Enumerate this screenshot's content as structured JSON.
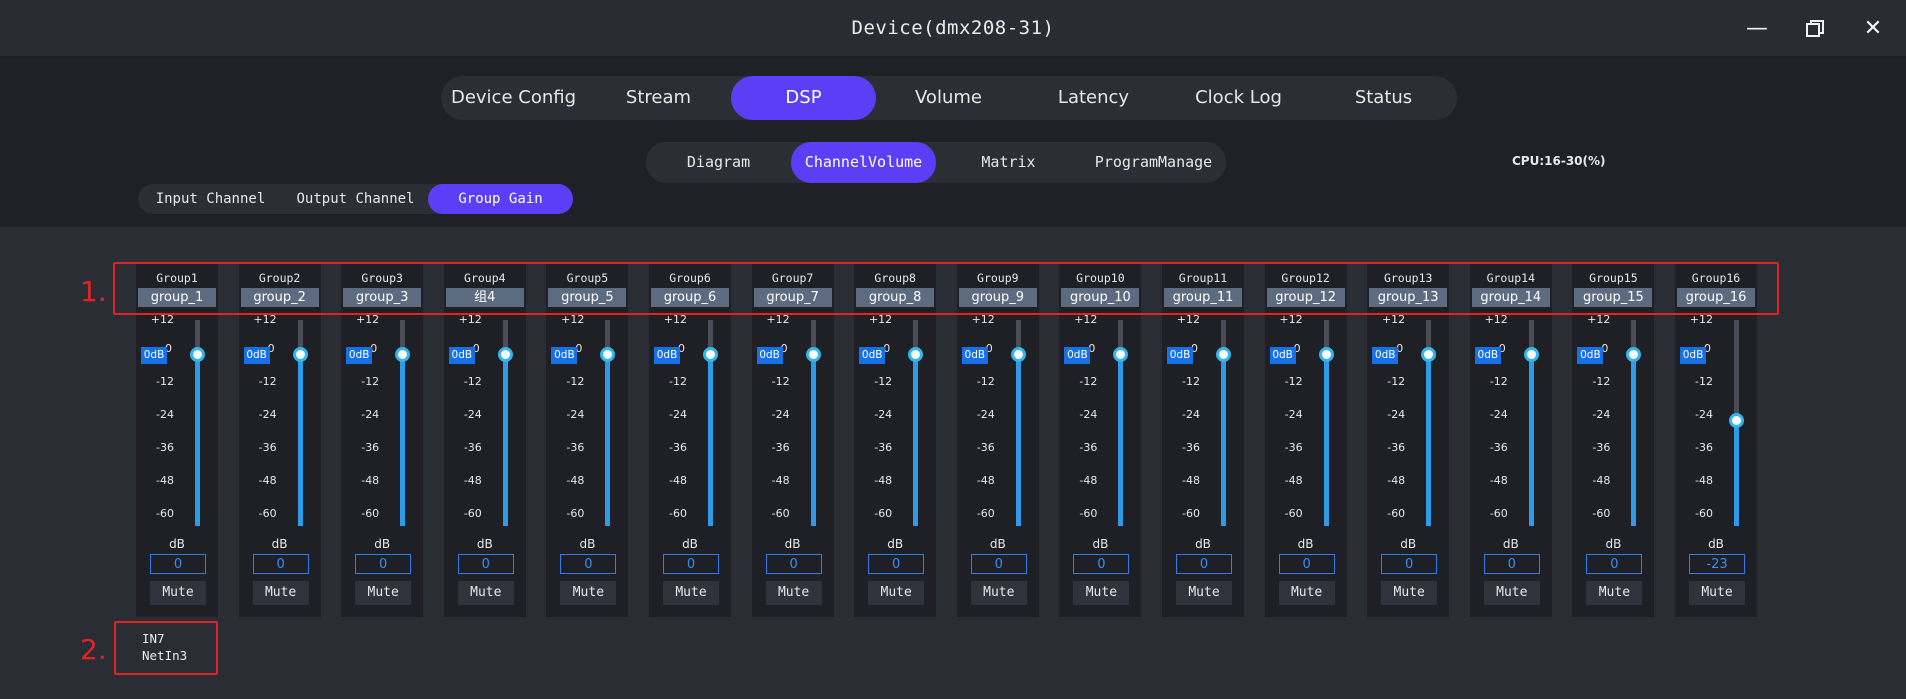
{
  "window": {
    "title": "Device(dmx208-31)",
    "minimize_icon": "minimize-icon",
    "restore_icon": "restore-icon",
    "close_icon": "close-icon"
  },
  "main_tabs": [
    {
      "label": "Device Config",
      "active": false
    },
    {
      "label": "Stream",
      "active": false
    },
    {
      "label": "DSP",
      "active": true
    },
    {
      "label": "Volume",
      "active": false
    },
    {
      "label": "Latency",
      "active": false
    },
    {
      "label": "Clock Log",
      "active": false
    },
    {
      "label": "Status",
      "active": false
    }
  ],
  "sub_tabs": [
    {
      "label": "Diagram",
      "active": false
    },
    {
      "label": "ChannelVolume",
      "active": true
    },
    {
      "label": "Matrix",
      "active": false
    },
    {
      "label": "ProgramManage",
      "active": false
    }
  ],
  "cpu": "CPU:16-30(%)",
  "channel_tabs": [
    {
      "label": "Input Channel",
      "active": false
    },
    {
      "label": "Output Channel",
      "active": false
    },
    {
      "label": "Group Gain",
      "active": true
    }
  ],
  "scale": [
    "+12",
    "0",
    "-12",
    "-24",
    "-36",
    "-48",
    "-60"
  ],
  "odb_badge": "0dB",
  "unit": "dB",
  "mute_label": "Mute",
  "gain_range_db": [
    -60,
    12
  ],
  "groups": [
    {
      "label": "Group1",
      "name": "group_1",
      "gain": 0
    },
    {
      "label": "Group2",
      "name": "group_2",
      "gain": 0
    },
    {
      "label": "Group3",
      "name": "group_3",
      "gain": 0
    },
    {
      "label": "Group4",
      "name": "组4",
      "gain": 0
    },
    {
      "label": "Group5",
      "name": "group_5",
      "gain": 0
    },
    {
      "label": "Group6",
      "name": "group_6",
      "gain": 0
    },
    {
      "label": "Group7",
      "name": "group_7",
      "gain": 0
    },
    {
      "label": "Group8",
      "name": "group_8",
      "gain": 0
    },
    {
      "label": "Group9",
      "name": "group_9",
      "gain": 0
    },
    {
      "label": "Group10",
      "name": "group_10",
      "gain": 0
    },
    {
      "label": "Group11",
      "name": "group_11",
      "gain": 0
    },
    {
      "label": "Group12",
      "name": "group_12",
      "gain": 0
    },
    {
      "label": "Group13",
      "name": "group_13",
      "gain": 0
    },
    {
      "label": "Group14",
      "name": "group_14",
      "gain": 0
    },
    {
      "label": "Group15",
      "name": "group_15",
      "gain": 0
    },
    {
      "label": "Group16",
      "name": "group_16",
      "gain": -23
    }
  ],
  "annotations": {
    "marker_1": "1.",
    "marker_2": "2."
  },
  "info_box": {
    "line1": "IN7",
    "line2": "NetIn3"
  },
  "colors": {
    "accent": "#5b3ef5",
    "fader_fill": "#2e9be8",
    "highlight_box": "#e02424"
  }
}
